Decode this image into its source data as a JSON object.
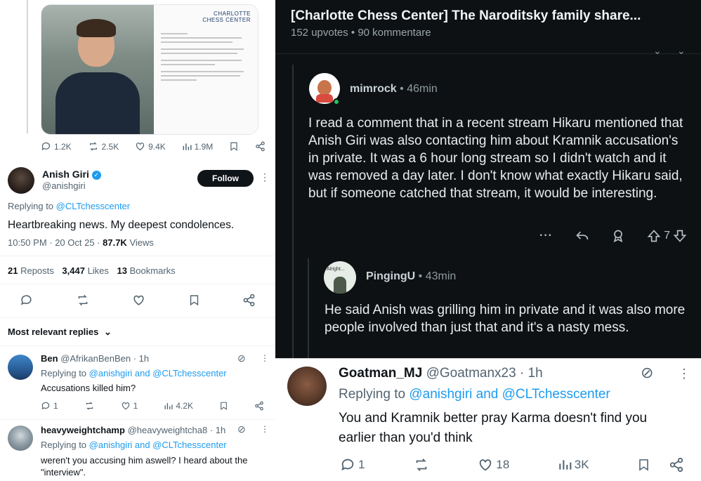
{
  "left": {
    "media": {
      "doc_logo_line1": "CHARLOTTE",
      "doc_logo_line2": "CHESS CENTER"
    },
    "media_stats": {
      "replies": "1.2K",
      "reposts": "2.5K",
      "likes": "9.4K",
      "views": "1.9M"
    },
    "main_tweet": {
      "name": "Anish Giri",
      "handle": "@anishgiri",
      "follow_label": "Follow",
      "replying_prefix": "Replying to",
      "replying_to": "@CLTchesscenter",
      "text": "Heartbreaking news. My deepest condolences.",
      "time": "10:50 PM · 20 Oct 25 · ",
      "views_count": "87.7K",
      "views_label": " Views",
      "reposts_count": "21",
      "reposts_label": " Reposts",
      "likes_count": "3,447",
      "likes_label": " Likes",
      "bookmarks_count": "13",
      "bookmarks_label": " Bookmarks"
    },
    "replies_header": "Most relevant replies",
    "reply1": {
      "name": "Ben",
      "handle": "@AfrikanBenBen · 1h",
      "replying_prefix": "Replying to",
      "replying_to": "@anishgiri and @CLTchesscenter",
      "text": "Accusations killed him?",
      "replies": "1",
      "likes": "1",
      "views": "4.2K"
    },
    "reply2": {
      "name": "heavyweightchamp",
      "handle": "@heavyweightcha8 · 1h",
      "replying_prefix": "Replying to",
      "replying_to": "@anishgiri and @CLTchesscenter",
      "text_line1": "weren't you accusing him aswell? I heard about the",
      "text_line2": "\"interview\"."
    }
  },
  "reddit": {
    "title": "[Charlotte Chess Center] The Naroditsky family share...",
    "subtitle": "152 upvotes • 90 kommentare",
    "comment1": {
      "user": "mimrock",
      "time": " • 46min",
      "text": "I read a comment that in a recent stream Hikaru mentioned that Anish Giri was also contacting him about Kramnik accusation's in private. It was a 6 hour long stream so I didn't watch and it was removed a day later. I don't know what exactly Hikaru said, but if someone catched that stream, it would be interesting.",
      "votes": "7"
    },
    "comment2": {
      "user": "PingingU",
      "time": " • 43min",
      "avatar_text": "Alright...",
      "text": "He said Anish was grilling him in private and it was also more people involved than just that and it's a nasty mess."
    }
  },
  "goatman": {
    "name": "Goatman_MJ",
    "handle": "@Goatmanx23 · 1h",
    "replying_prefix": "Replying to",
    "replying_to": "@anishgiri and @CLTchesscenter",
    "text_line1": "You and Kramnik better pray Karma doesn't find you",
    "text_line2": "earlier than you'd think",
    "replies": "1",
    "likes": "18",
    "views": "3K"
  },
  "colors": {
    "x_blue": "#1d9bf0",
    "reddit_bg": "#0e1113"
  }
}
